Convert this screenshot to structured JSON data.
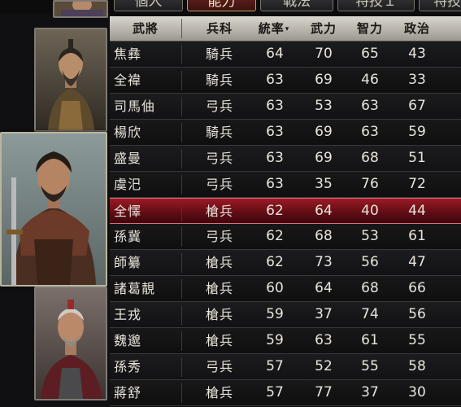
{
  "tabs": [
    {
      "label": "個人",
      "active": false
    },
    {
      "label": "能力",
      "active": true
    },
    {
      "label": "戦法",
      "active": false
    },
    {
      "label": "特技１",
      "active": false
    },
    {
      "label": "特技",
      "active": false
    }
  ],
  "table": {
    "headers": {
      "name": "武將",
      "type": "兵科",
      "lead": "統率",
      "war": "武力",
      "int": "智力",
      "pol": "政治"
    },
    "sort_indicator": "▾",
    "rows": [
      {
        "name": "焦彝",
        "type": "騎兵",
        "lead": "64",
        "war": "70",
        "int": "65",
        "pol": "43"
      },
      {
        "name": "全禕",
        "type": "騎兵",
        "lead": "63",
        "war": "69",
        "int": "46",
        "pol": "33"
      },
      {
        "name": "司馬伷",
        "type": "弓兵",
        "lead": "63",
        "war": "53",
        "int": "63",
        "pol": "67"
      },
      {
        "name": "楊欣",
        "type": "騎兵",
        "lead": "63",
        "war": "69",
        "int": "63",
        "pol": "59"
      },
      {
        "name": "盛曼",
        "type": "弓兵",
        "lead": "63",
        "war": "69",
        "int": "68",
        "pol": "51"
      },
      {
        "name": "虞汜",
        "type": "弓兵",
        "lead": "63",
        "war": "35",
        "int": "76",
        "pol": "72"
      },
      {
        "name": "全懌",
        "type": "槍兵",
        "lead": "62",
        "war": "64",
        "int": "40",
        "pol": "44",
        "selected": true
      },
      {
        "name": "孫冀",
        "type": "弓兵",
        "lead": "62",
        "war": "68",
        "int": "53",
        "pol": "61"
      },
      {
        "name": "師纂",
        "type": "槍兵",
        "lead": "62",
        "war": "73",
        "int": "56",
        "pol": "47"
      },
      {
        "name": "諸葛靚",
        "type": "槍兵",
        "lead": "60",
        "war": "64",
        "int": "68",
        "pol": "66"
      },
      {
        "name": "王戎",
        "type": "槍兵",
        "lead": "59",
        "war": "37",
        "int": "74",
        "pol": "56"
      },
      {
        "name": "魏邈",
        "type": "槍兵",
        "lead": "59",
        "war": "63",
        "int": "61",
        "pol": "55"
      },
      {
        "name": "孫秀",
        "type": "弓兵",
        "lead": "57",
        "war": "52",
        "int": "55",
        "pol": "58"
      },
      {
        "name": "蔣舒",
        "type": "槍兵",
        "lead": "57",
        "war": "77",
        "int": "37",
        "pol": "30"
      }
    ]
  },
  "colors": {
    "selected_row": "#7a1420",
    "header_bg": "#c8c5bd",
    "active_tab": "#5a1c18"
  }
}
